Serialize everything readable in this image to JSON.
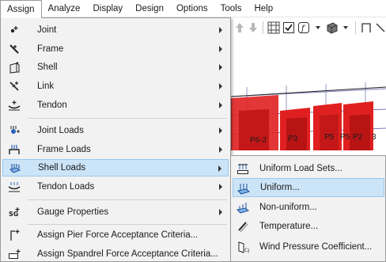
{
  "menubar": {
    "items": [
      "Assign",
      "Analyze",
      "Display",
      "Design",
      "Options",
      "Tools",
      "Help"
    ]
  },
  "assign_menu": {
    "items": [
      {
        "label": "Joint",
        "icon": "joint-icon",
        "submenu": true
      },
      {
        "label": "Frame",
        "icon": "frame-icon",
        "submenu": true
      },
      {
        "label": "Shell",
        "icon": "shell-icon",
        "submenu": true
      },
      {
        "label": "Link",
        "icon": "link-icon",
        "submenu": true
      },
      {
        "label": "Tendon",
        "icon": "tendon-icon",
        "submenu": true
      },
      {
        "label": "Joint Loads",
        "icon": "joint-loads-icon",
        "submenu": true
      },
      {
        "label": "Frame Loads",
        "icon": "frame-loads-icon",
        "submenu": true
      },
      {
        "label": "Shell Loads",
        "icon": "shell-loads-icon",
        "submenu": true
      },
      {
        "label": "Tendon Loads",
        "icon": "tendon-loads-icon",
        "submenu": true
      },
      {
        "label": "Gauge Properties",
        "icon": "gauge-properties-icon",
        "submenu": true
      },
      {
        "label": "Assign Pier Force Acceptance Criteria...",
        "icon": "pier-criteria-icon",
        "submenu": false
      },
      {
        "label": "Assign Spandrel Force Acceptance Criteria...",
        "icon": "spandrel-criteria-icon",
        "submenu": false
      }
    ],
    "highlighted": "Shell Loads"
  },
  "shell_loads_submenu": {
    "items": [
      {
        "label": "Uniform Load Sets...",
        "icon": "uniform-load-sets-icon"
      },
      {
        "label": "Uniform...",
        "icon": "uniform-load-icon"
      },
      {
        "label": "Non-uniform...",
        "icon": "non-uniform-load-icon"
      },
      {
        "label": "Temperature...",
        "icon": "temperature-icon"
      },
      {
        "label": "Wind Pressure Coefficient...",
        "icon": "wind-pressure-icon"
      }
    ],
    "highlighted": "Uniform..."
  },
  "model_view": {
    "labels": [
      "P6-2",
      "P3",
      "P5",
      "P5",
      "P2",
      "3"
    ]
  },
  "colors": {
    "menu_bg": "#f2f2f2",
    "highlight_bg": "#cce4f7",
    "highlight_border": "#99c9ef",
    "model_red": "#e02020"
  }
}
